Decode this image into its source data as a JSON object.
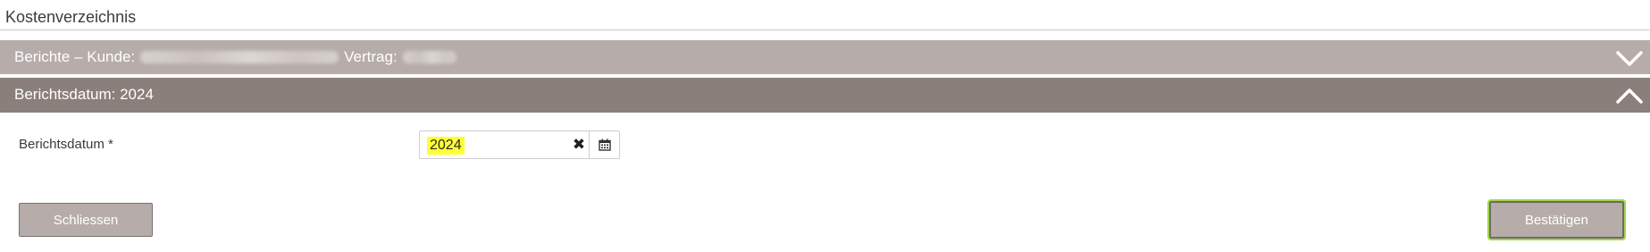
{
  "page": {
    "title": "Kostenverzeichnis"
  },
  "accordion_reports": {
    "prefix": "Berichte – Kunde:",
    "contract_label": "Vertrag:",
    "state": "collapsed",
    "icon": "chevron-down-icon"
  },
  "accordion_date": {
    "title": "Berichtsdatum: 2024",
    "state": "expanded",
    "icon": "chevron-up-icon"
  },
  "form": {
    "date_label": "Berichtsdatum *",
    "date_value": "2024",
    "clear_icon": "clear-icon",
    "calendar_icon": "calendar-icon"
  },
  "buttons": {
    "close_label": "Schliessen",
    "confirm_label": "Bestätigen"
  },
  "colors": {
    "header_light": "#b6adaa",
    "header_dark": "#8b7f7b",
    "highlight": "#ffff33",
    "focus_outline": "#9fd64a"
  }
}
